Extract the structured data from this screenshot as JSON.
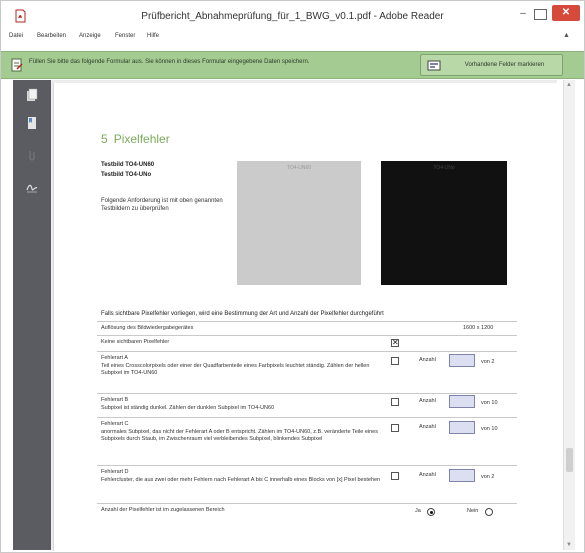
{
  "window": {
    "title": "Prüfbericht_Abnahmeprüfung_für_1_BWG_v0.1.pdf - Adobe Reader",
    "min_glyph": "–",
    "max_glyph": "",
    "close_glyph": "✕"
  },
  "menu": {
    "items": [
      "Datei",
      "Bearbeiten",
      "Anzeige",
      "Fenster",
      "Hilfe"
    ],
    "overflow_glyph": "▲"
  },
  "form_bar": {
    "message": "Füllen Sie bitte das folgende Formular aus. Sie können in dieses Formular eingegebene Daten speichern.",
    "highlight_button": "Vorhandene Felder markieren"
  },
  "colors": {
    "accent_green": "#7bab5a",
    "form_bar": "#a4cc92",
    "nav_pane": "#5b5c62",
    "field_fill": "#dcdff2"
  },
  "nav_icons": [
    "pages-icon",
    "bookmarks-icon",
    "attachments-icon",
    "signatures-icon"
  ],
  "document": {
    "section_number": "5",
    "section_title": "Pixelfehler",
    "testbild_1": "Testbild TO4-UN60",
    "testbild_2": "Testbild TO4-UNo",
    "requirement": "Folgende Anforderung ist mit oben genannten Testbildern zu überprüfen",
    "gray_image_label": "TO4-UN60",
    "black_image_label": "TO4-UNo",
    "intro": "Falls sichtbare Pixelfehler vorliegen, wird eine Bestimmung der Art und Anzahl der Pixelfehler durchgeführt",
    "rows": [
      {
        "text": "Auflösung des Bildwiedergabegerätes",
        "value": "1600 x 1200"
      },
      {
        "text": "Keine sichtbaren Pixelfehler"
      },
      {
        "text": "Fehlerart A\nTeil eines Crosscolorpixels oder einer der Quadfarbenteile eines Farbpixels leuchtet ständig. Zählen der hellen Subpixel im TO4-UN60",
        "label": "Anzahl",
        "of": "von 2"
      },
      {
        "text": "Fehlerart B\nSubpixel ist ständig dunkel. Zählen der dunklen Subpixel im TO4-UN60",
        "label": "Anzahl",
        "of": "von 10"
      },
      {
        "text": "Fehlerart C\nanormales Subpixel, das nicht der Fehlerart A oder B entspricht. Zählen im TO4-UN60, z.B. veränderte Teile eines Subpixels durch Staub, im Zwischenraum viel verbleibendes Subpixel, blinkendes Subpixel",
        "label": "Anzahl",
        "of": "von 10"
      },
      {
        "text": "Fehlerart D\nFehlercluster, die aus zwei oder mehr Fehlern nach Fehlerart A bis C innerhalb eines Blocks von [x] Pixel bestehen",
        "label": "Anzahl",
        "of": "von 2"
      },
      {
        "text": "Anzahl der Pixelfehler ist im zugelassenen Bereich",
        "yes": "Ja",
        "no": "Nein"
      }
    ]
  }
}
